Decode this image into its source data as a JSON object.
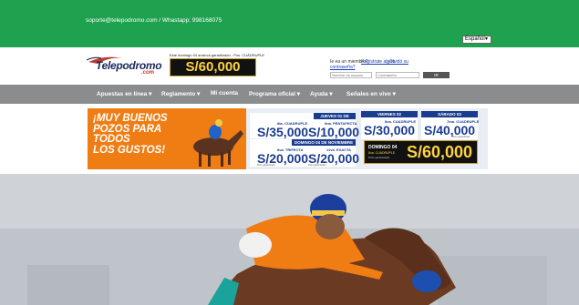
{
  "topbar": {
    "contact": "soporte@telepodromo.com / Whastapp: 998168075",
    "language": "Español"
  },
  "header": {
    "logo_text": "Telepodromo",
    "logo_suffix": ".com",
    "promo_caption": "Este domingo 04 arranca garantizado - Pos. CUÁDRUPLE",
    "promo_amount": "S/60,000"
  },
  "login": {
    "question": "Ie ea un miembro?",
    "register_link": "Regístrate ahora",
    "forgot_link": "¿Olvidó su",
    "forgot_link_2": "contraseña?",
    "user_placeholder": "Nombre de usuario",
    "pass_placeholder": "Contraseña",
    "submit_label": "IR"
  },
  "nav": {
    "items": [
      "Apuestas en línea ▾",
      "Reglamento ▾",
      "Mi cuenta",
      "Programa oficial ▾",
      "Ayuda ▾",
      "Señales en vivo ▾"
    ]
  },
  "banner": {
    "slogan_1": "¡MUY BUENOS",
    "slogan_2": "POZOS PARA TODOS",
    "slogan_3": "LOS GUSTOS!",
    "jueves": {
      "header": "JUEVES 01 DE NOVIEMBRE",
      "left_label": "8ta. CUADRUPLE",
      "left_amount": "S/35,000",
      "left_fine": "Pozo garantizado",
      "right_label": "9na. PENTAFECTA",
      "right_amount": "S/10,000",
      "right_fine": "Pozo garantizado"
    },
    "domingo": {
      "header": "DOMINGO 04 DE NOVIEMBRE",
      "left_label": "8va. TRIFECTA",
      "left_amount": "S/20,000",
      "left_fine": "Pozo garantizado",
      "right_label": "11va. EXACTA",
      "right_amount": "S/20,000",
      "right_fine": "Pozo garantizado"
    },
    "viernes": {
      "header": "VIERNES 02",
      "label": "8va. CUADRUPLE",
      "amount": "S/30,000",
      "fine": "Pozo garantizado"
    },
    "sabado": {
      "header": "SÁBADO 03",
      "label": "7ma. CUADRUPLE",
      "amount": "S/40,000",
      "fine": "Pozo garantizado"
    },
    "gold": {
      "day": "DOMINGO 04",
      "label": "8va. CUADRUPLE",
      "fine": "Pozo garantizado",
      "amount": "S/60,000"
    }
  },
  "colors": {
    "topbar": "#1ea24f",
    "nav": "#8a8c8e",
    "banner_orange": "#ef7d14",
    "banner_blue": "#1a3c8e",
    "gold": "#ffd23f"
  }
}
